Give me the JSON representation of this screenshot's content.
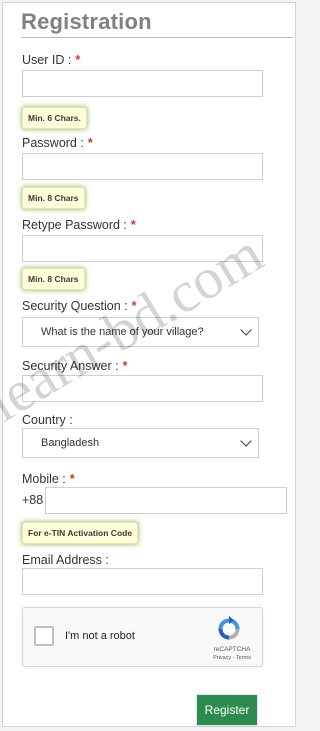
{
  "form": {
    "title": "Registration",
    "fields": {
      "user_id": {
        "label": "User ID :",
        "required_mark": "*",
        "value": "",
        "hint": "Min. 6 Chars."
      },
      "password": {
        "label": "Password :",
        "required_mark": "*",
        "value": "",
        "hint": "Min. 8 Chars"
      },
      "retype_password": {
        "label": "Retype Password :",
        "required_mark": "*",
        "value": "",
        "hint": "Min. 8 Chars"
      },
      "security_question": {
        "label": "Security Question :",
        "required_mark": "*",
        "selected": "What is the name of your village?"
      },
      "security_answer": {
        "label": "Security Answer :",
        "required_mark": "*",
        "value": ""
      },
      "country": {
        "label": "Country :",
        "selected": "Bangladesh"
      },
      "mobile": {
        "label": "Mobile :",
        "required_mark": "*",
        "prefix": "+88",
        "value": "",
        "hint": "For e-TIN Activation Code"
      },
      "email": {
        "label": "Email Address :",
        "value": ""
      }
    },
    "captcha": {
      "checkbox_label": "I'm not a robot",
      "brand": "reCAPTCHA",
      "links": "Privacy - Terms",
      "logo_icon": "recaptcha-icon"
    },
    "submit_label": "Register"
  },
  "watermark": "learn-bd.com",
  "colors": {
    "title": "#808080",
    "required": "#d9332e",
    "hint_bg": "#ffffd9",
    "hint_glow": "#8caa3c",
    "submit_bg": "#2e8b4f"
  }
}
